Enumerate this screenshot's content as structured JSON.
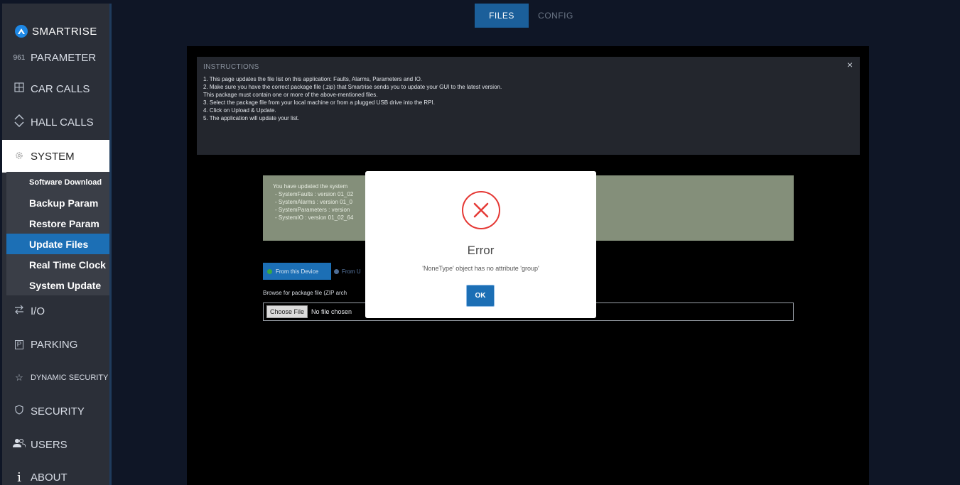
{
  "sidebar": {
    "logo": "SMARTRISE",
    "nav": {
      "parameter": {
        "icon_text": "961",
        "label": "PARAMETER"
      },
      "car_calls": {
        "label": "CAR CALLS"
      },
      "hall_calls": {
        "label": "HALL CALLS"
      },
      "system": {
        "label": "SYSTEM"
      },
      "io": {
        "label": "I/O"
      },
      "parking": {
        "icon_text": "P",
        "label": "PARKING"
      },
      "dynamic_security": {
        "label": "DYNAMIC SECURITY"
      },
      "security": {
        "label": "SECURITY"
      },
      "users": {
        "label": "USERS"
      },
      "about": {
        "icon_text": "i",
        "label": "ABOUT"
      }
    },
    "system_sub": [
      {
        "label": "Software Download"
      },
      {
        "label": "Backup Param"
      },
      {
        "label": "Restore Param"
      },
      {
        "label": "Update Files"
      },
      {
        "label": "Real Time Clock"
      },
      {
        "label": "System Update"
      }
    ],
    "selected_sub": "Update Files"
  },
  "tabs": {
    "files": "FILES",
    "config": "CONFIG",
    "active": "FILES"
  },
  "instructions": {
    "heading": "INSTRUCTIONS",
    "lines": [
      "1. This page updates the file list on this application: Faults, Alarms, Parameters and IO.",
      "2. Make sure you have the correct package file (.zip) that Smartrise sends you to update your GUI to the latest version.",
      "This package must contain one or more of the above-mentioned files.",
      "3. Select the package file from your local machine or from a plugged USB drive into the RPI.",
      "4. Click on Upload & Update.",
      "5. The application will update your list."
    ],
    "close": "×"
  },
  "status_box": {
    "lines": [
      "You have updated the system",
      "- SystemFaults : version 01_02",
      "- SystemAlarms : version 01_0",
      "- SystemParameters : version",
      "- SystemIO : version 01_02_64"
    ]
  },
  "source": {
    "device": "From this Device",
    "usb": "From U"
  },
  "browse_label": "Browse for package file (ZIP arch",
  "file_input": {
    "button": "Choose File",
    "value": "No file chosen"
  },
  "modal": {
    "title": "Error",
    "message": "'NoneType' object has no attribute 'group'",
    "ok": "OK"
  },
  "colors": {
    "accent": "#1c6fb5",
    "error": "#e53935"
  }
}
